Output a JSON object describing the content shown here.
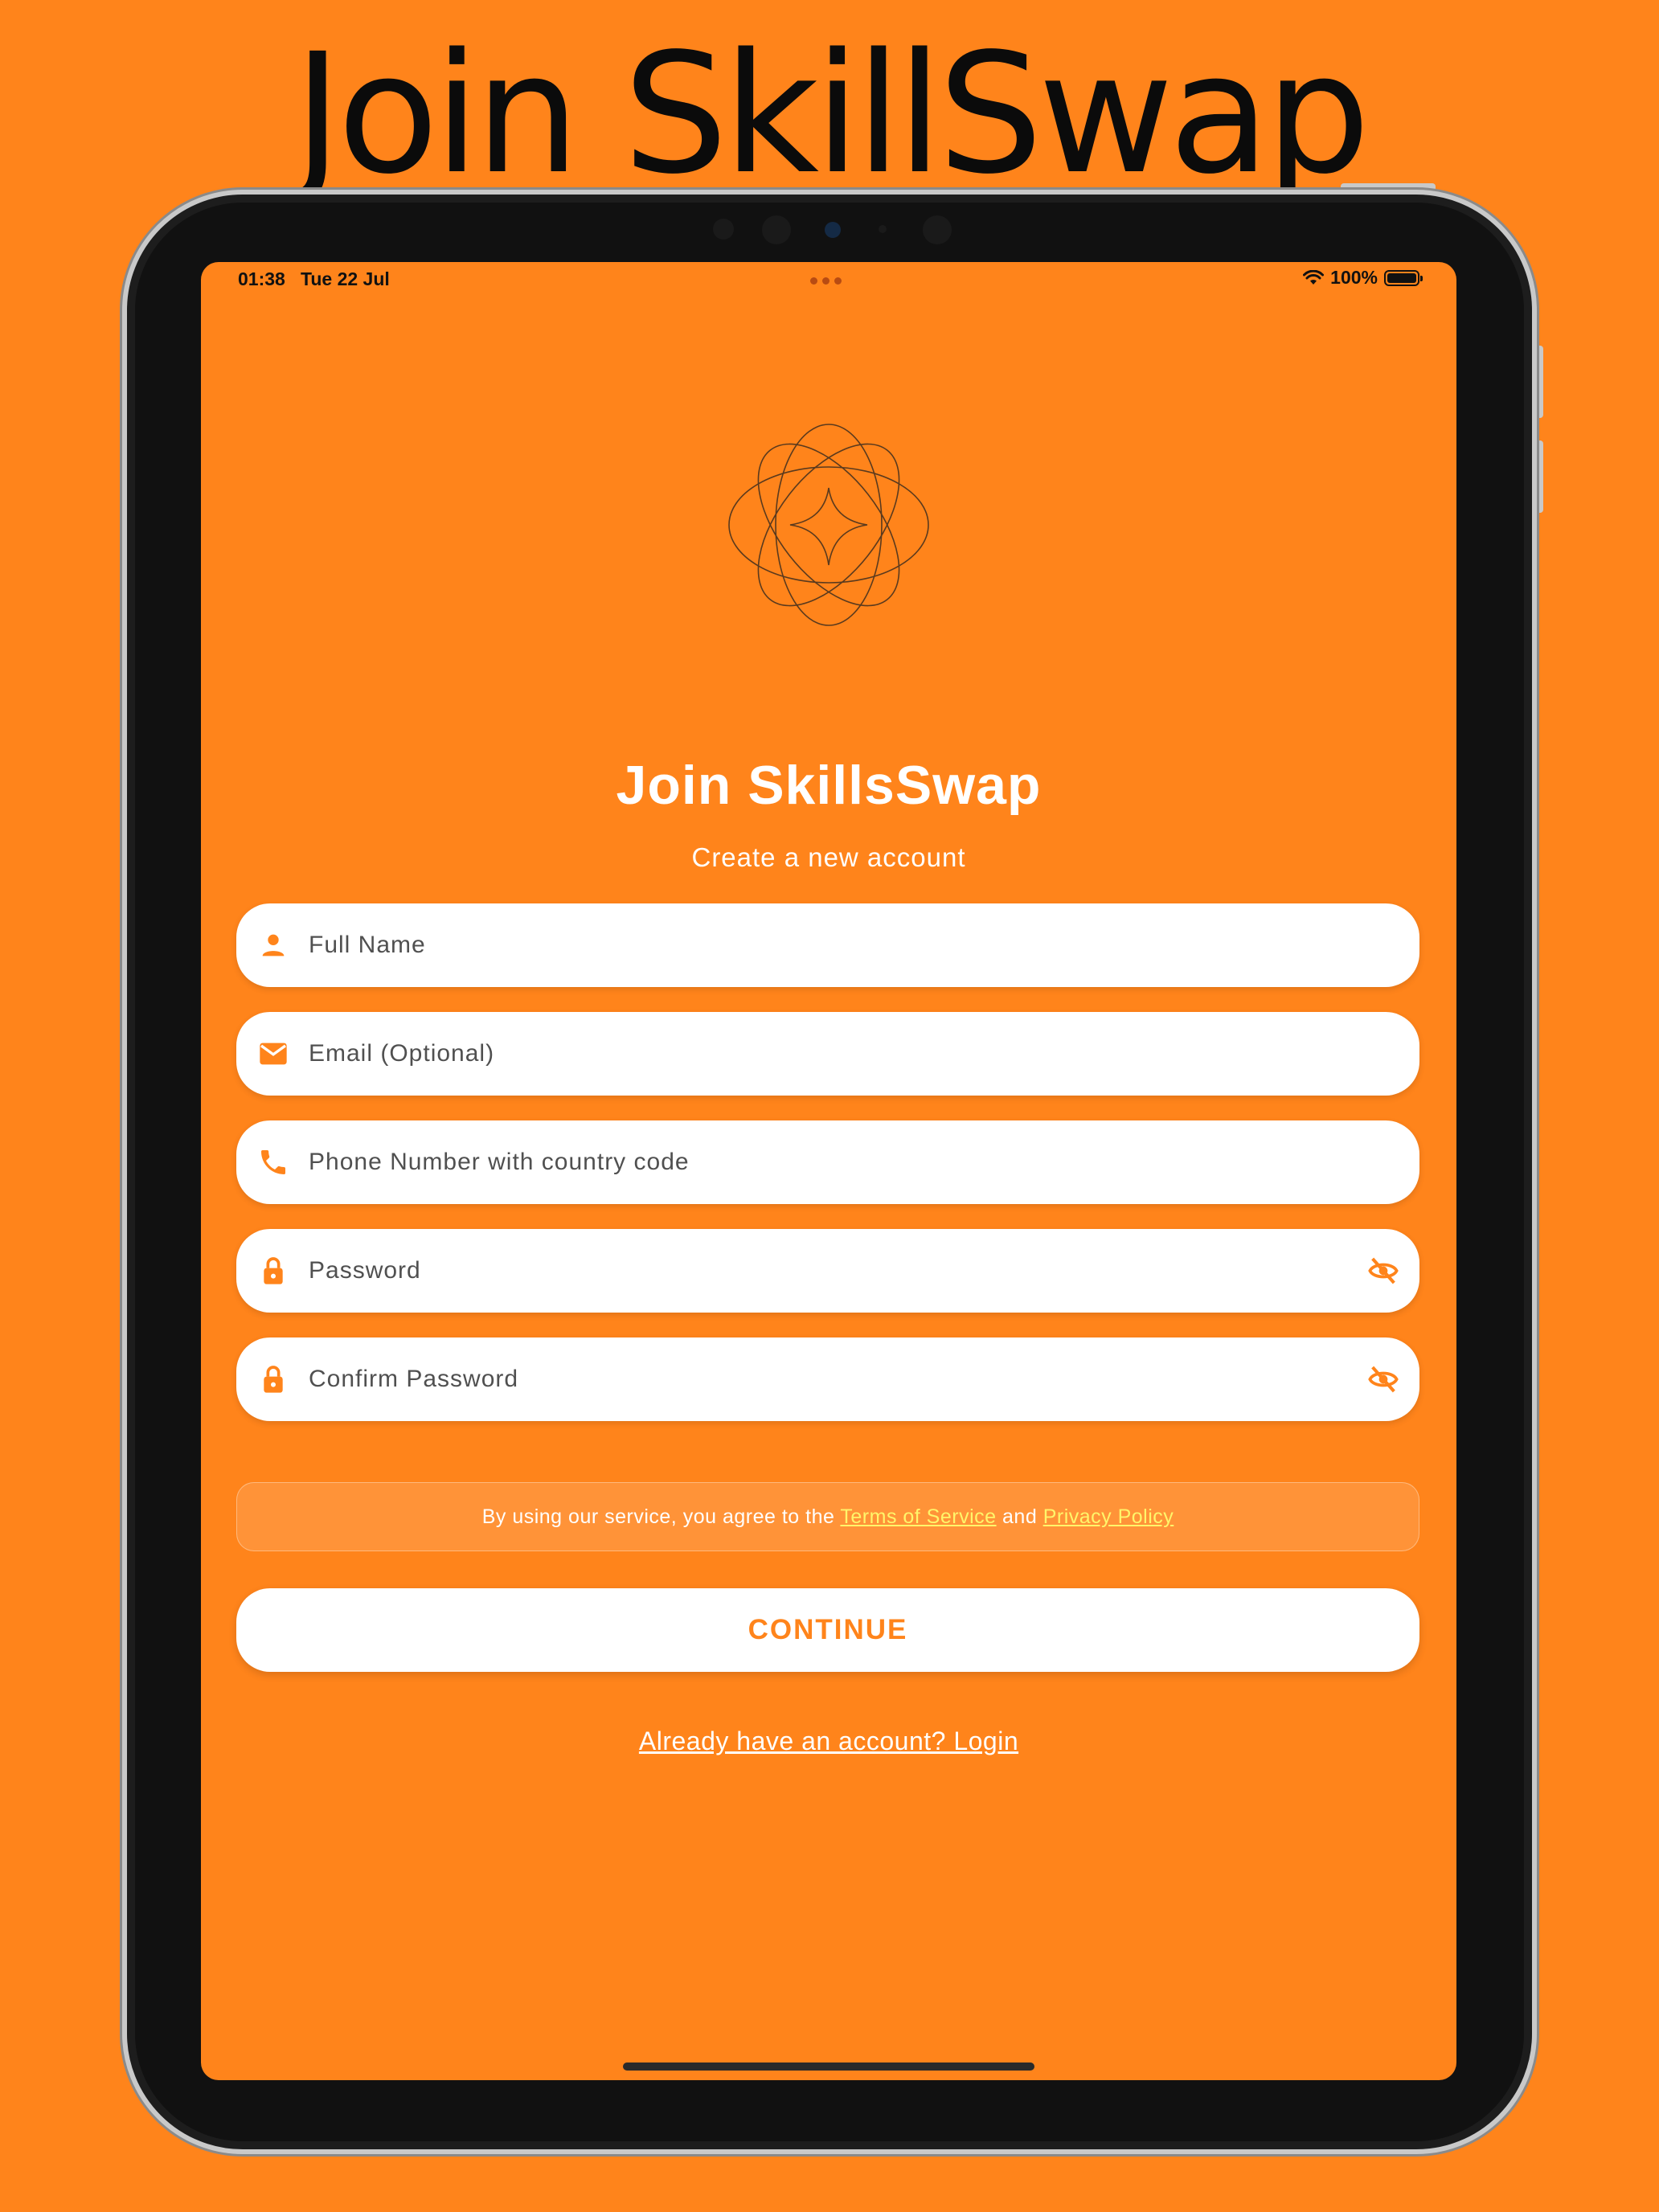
{
  "marketing": {
    "headline": "Join SkillSwap"
  },
  "status_bar": {
    "time": "01:38",
    "date": "Tue 22 Jul",
    "battery": "100%"
  },
  "screen": {
    "title": "Join SkillsSwap",
    "subtitle": "Create a new account",
    "fields": [
      {
        "placeholder": "Full Name",
        "icon": "person-icon"
      },
      {
        "placeholder": "Email (Optional)",
        "icon": "mail-icon"
      },
      {
        "placeholder": "Phone Number with country code",
        "icon": "phone-icon"
      },
      {
        "placeholder": "Password",
        "icon": "lock-icon",
        "trailing_icon": "eye-off-icon"
      },
      {
        "placeholder": "Confirm Password",
        "icon": "lock-icon",
        "trailing_icon": "eye-off-icon"
      }
    ],
    "terms": {
      "prefix": "By using our service, you agree to the",
      "terms_link": "Terms of Service",
      "conjunction": "and",
      "privacy_link": "Privacy Policy"
    },
    "continue_label": "CONTINUE",
    "login_link": "Already have an account? Login"
  },
  "colors": {
    "accent": "#FF841B",
    "link": "#FFF56A",
    "surface": "#FFFFFF"
  }
}
